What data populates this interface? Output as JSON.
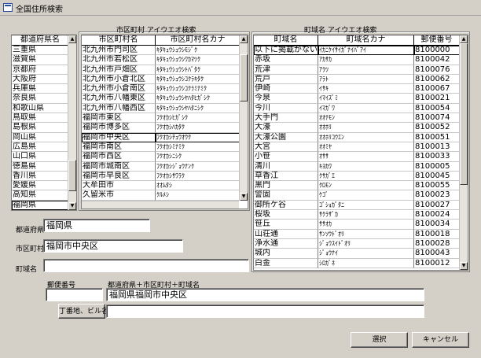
{
  "window": {
    "title": "全国住所検索"
  },
  "pref": {
    "header": "都道府県名",
    "items": [
      "三重県",
      "滋賀県",
      "京都府",
      "大阪府",
      "兵庫県",
      "奈良県",
      "和歌山県",
      "鳥取県",
      "島根県",
      "岡山県",
      "広島県",
      "山口県",
      "徳島県",
      "香川県",
      "愛媛県",
      "高知県",
      "福岡県"
    ]
  },
  "city": {
    "caption": "市区町村 アイウエオ検索",
    "headers": [
      "市区町村名",
      "市区町村名カナ"
    ],
    "rows": [
      [
        "北九州市門司区",
        "ｷﾀｷｭｳｼｭｳｼﾓｼﾞｸ"
      ],
      [
        "北九州市若松区",
        "ｷﾀｷｭｳｼｭｳｼﾜｶﾏﾂｸ"
      ],
      [
        "北九州市戸畑区",
        "ｷﾀｷｭｳｼｭｳｼﾄﾊﾞﾀｸ"
      ],
      [
        "北九州市小倉北区",
        "ｷﾀｷｭｳｼｭｳｼｺｸﾗｷﾀｸ"
      ],
      [
        "北九州市小倉南区",
        "ｷﾀｷｭｳｼｭｳｼｺｸﾗﾐﾅﾐｸ"
      ],
      [
        "北九州市八幡東区",
        "ｷﾀｷｭｳｼｭｳｼﾔﾊﾀﾋｶﾞｼｸ"
      ],
      [
        "北九州市八幡西区",
        "ｷﾀｷｭｳｼｭｳｼﾔﾊﾀﾆｼｸ"
      ],
      [
        "福岡市東区",
        "ﾌｸｵｶｼﾋｶﾞｼｸ"
      ],
      [
        "福岡市博多区",
        "ﾌｸｵｶｼﾊｶﾀｸ"
      ],
      [
        "福岡市中央区",
        "ﾌｸｵｶｼﾁｭｳｵｳｸ"
      ],
      [
        "福岡市南区",
        "ﾌｸｵｶｼﾐﾅﾐｸ"
      ],
      [
        "福岡市西区",
        "ﾌｸｵｶｼﾆｼｸ"
      ],
      [
        "福岡市城南区",
        "ﾌｸｵｶｼｼﾞｮｳﾅﾝｸ"
      ],
      [
        "福岡市早良区",
        "ﾌｸｵｶｼｻﾜﾗｸ"
      ],
      [
        "大牟田市",
        "ｵｵﾑﾀｼ"
      ],
      [
        "久留米市",
        "ｸﾙﾒｼ"
      ]
    ]
  },
  "town": {
    "caption": "町域名 アイウエオ検索",
    "headers": [
      "町域名",
      "町域名カナ",
      "郵便番号"
    ],
    "rows": [
      [
        "以下に掲載がない場合",
        "ｲｶﾆｹｲｻｲｶﾞﾅｲﾊﾞｱｲ",
        "8100000"
      ],
      [
        "赤坂",
        "ｱｶｻｶ",
        "8100042"
      ],
      [
        "荒津",
        "ｱﾗﾂ",
        "8100076"
      ],
      [
        "荒戸",
        "ｱﾗﾄ",
        "8100062"
      ],
      [
        "伊崎",
        "ｲｻｷ",
        "8100067"
      ],
      [
        "今泉",
        "ｲﾏｲｽﾞﾐ",
        "8100021"
      ],
      [
        "今川",
        "ｲﾏｶﾞﾜ",
        "8100054"
      ],
      [
        "大手門",
        "ｵｵﾃﾓﾝ",
        "8100074"
      ],
      [
        "大濠",
        "ｵｵﾎﾘ",
        "8100052"
      ],
      [
        "大濠公園",
        "ｵｵﾎﾘｺｳｴﾝ",
        "8100051"
      ],
      [
        "大宮",
        "ｵｵﾐﾔ",
        "8100013"
      ],
      [
        "小笹",
        "ｵｻｻ",
        "8100033"
      ],
      [
        "清川",
        "ｷﾖｶﾜ",
        "8100005"
      ],
      [
        "草香江",
        "ｸｻｶﾞｴ",
        "8100045"
      ],
      [
        "黒門",
        "ｸﾛﾓﾝ",
        "8100055"
      ],
      [
        "警固",
        "ｹｺﾞ",
        "8100023"
      ],
      [
        "御所ケ谷",
        "ｺﾞｼｮｶﾞﾀﾆ",
        "8100027"
      ],
      [
        "桜坂",
        "ｻｸﾗｻﾞｶ",
        "8100024"
      ],
      [
        "笹丘",
        "ｻｻｵｶ",
        "8100034"
      ],
      [
        "山荘通",
        "ｻﾝｿｳﾄﾞｵﾘ",
        "8100018"
      ],
      [
        "浄水通",
        "ｼﾞｮｳｽｲﾄﾞｵﾘ",
        "8100028"
      ],
      [
        "城内",
        "ｼﾞｮｳﾅｲ",
        "8100043"
      ],
      [
        "白金",
        "ｼﾛｶﾞﾈ",
        "8100012"
      ]
    ]
  },
  "fields": {
    "pref_label": "都道府県",
    "pref_value": "福岡県",
    "city_label": "市区町村",
    "city_value": "福岡市中央区",
    "town_label": "町域名",
    "town_value": "",
    "postal_label": "郵便番号",
    "postal_value": "",
    "combined_label": "都道府県＋市区町村＋町域名",
    "combined_value": "福岡県福岡市中央区",
    "chome_button": "丁番地、ビル名",
    "chome_value": ""
  },
  "buttons": {
    "ok": "選択",
    "cancel": "キャンセル"
  }
}
